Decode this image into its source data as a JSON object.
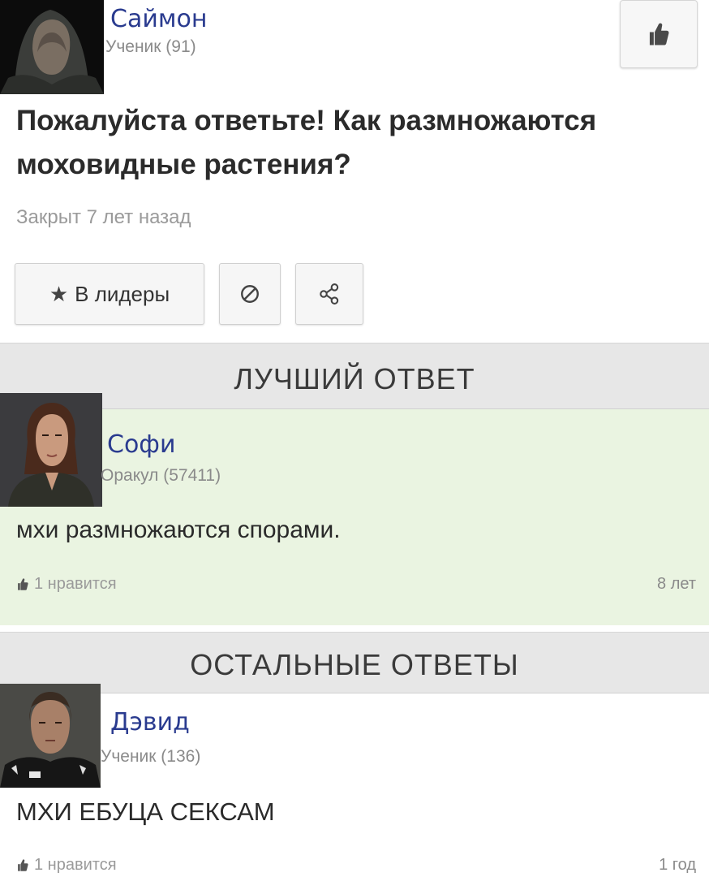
{
  "question": {
    "author": {
      "name": "Саймон",
      "rank": "Ученик (91)"
    },
    "title": "Пожалуйста ответьте! Как размножаются моховидные растения?",
    "status": "Закрыт 7 лет назад",
    "actions": {
      "leaders_label": "В лидеры",
      "star_glyph": "★"
    }
  },
  "best_answer": {
    "header": "ЛУЧШИЙ ОТВЕТ",
    "author": {
      "name": "Софи",
      "rank": "Оракул (57411)"
    },
    "text": "мхи размножаются спорами.",
    "likes": "1 нравится",
    "age": "8 лет"
  },
  "other_answers": {
    "header": "ОСТАЛЬНЫЕ ОТВЕТЫ",
    "items": [
      {
        "author": {
          "name": "Дэвид",
          "rank": "Ученик (136)"
        },
        "text": "МХИ ЕБУЦА СЕКСАМ",
        "likes": "1 нравится",
        "age": "1 год"
      }
    ]
  },
  "icons": {
    "like": "thumbs-up-icon",
    "report": "ban-icon",
    "share": "share-icon",
    "star": "star-icon"
  }
}
